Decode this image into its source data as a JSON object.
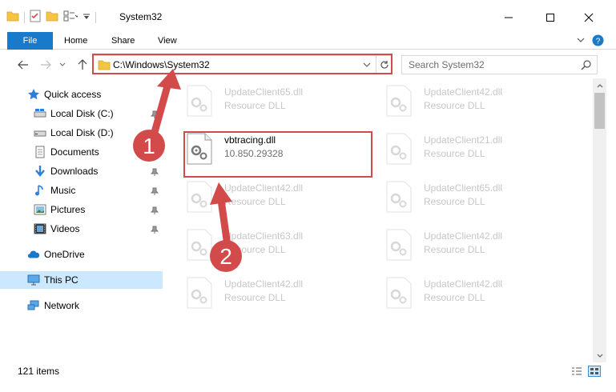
{
  "window": {
    "title": "System32",
    "minimize_label": "Minimize",
    "maximize_label": "Maximize",
    "close_label": "Close"
  },
  "ribbon": {
    "tabs": [
      "File",
      "Home",
      "Share",
      "View"
    ]
  },
  "address_bar": {
    "path": "C:\\Windows\\System32"
  },
  "search": {
    "placeholder": "Search System32"
  },
  "sidebar": {
    "items": [
      {
        "label": "Quick access",
        "icon": "star-icon"
      },
      {
        "label": "Local Disk (C:)",
        "icon": "drive-icon"
      },
      {
        "label": "Local Disk (D:)",
        "icon": "drive-icon"
      },
      {
        "label": "Documents",
        "icon": "documents-icon"
      },
      {
        "label": "Downloads",
        "icon": "download-icon"
      },
      {
        "label": "Music",
        "icon": "music-icon"
      },
      {
        "label": "Pictures",
        "icon": "pictures-icon"
      },
      {
        "label": "Videos",
        "icon": "videos-icon"
      },
      {
        "label": "OneDrive",
        "icon": "cloud-icon"
      },
      {
        "label": "This PC",
        "icon": "computer-icon"
      },
      {
        "label": "Network",
        "icon": "network-icon"
      }
    ],
    "selected": "This PC"
  },
  "files": [
    {
      "name": "UpdateClient65.dll",
      "type": "Resource DLL"
    },
    {
      "name": "UpdateClient42.dll",
      "type": "Resource DLL"
    },
    {
      "name": "vbtracing.dll",
      "type": "10.850.29328"
    },
    {
      "name": "UpdateClient21.dll",
      "type": "Resource DLL"
    },
    {
      "name": "UpdateClient42.dll",
      "type": "Resource DLL"
    },
    {
      "name": "UpdateClient65.dll",
      "type": "Resource DLL"
    },
    {
      "name": "UpdateClient63.dll",
      "type": "Resource DLL"
    },
    {
      "name": "UpdateClient42.dll",
      "type": "Resource DLL"
    },
    {
      "name": "UpdateClient42.dll",
      "type": "Resource DLL"
    },
    {
      "name": "UpdateClient42.dll",
      "type": "Resource DLL"
    }
  ],
  "status": {
    "item_count": "121 items"
  },
  "annotations": {
    "step1": "1",
    "step2": "2",
    "color": "#d24a4a"
  },
  "colors": {
    "accent": "#1979ca",
    "highlight": "#d24a4a",
    "selected_bg": "#cce8ff"
  }
}
